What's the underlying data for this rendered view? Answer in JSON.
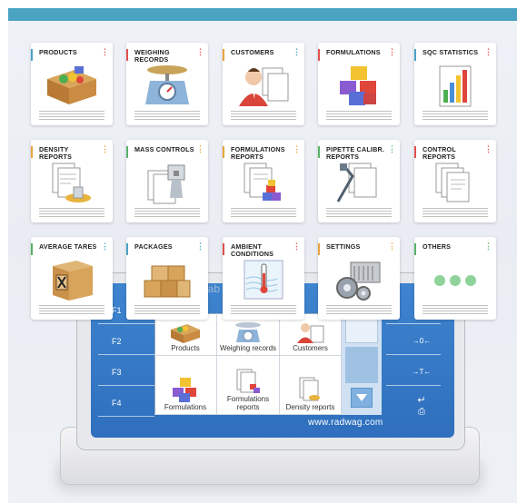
{
  "colors": {
    "red": "#e05050",
    "blue": "#4aa3c3",
    "yellow": "#e8a33c",
    "green": "#58b26a"
  },
  "cards": [
    {
      "title": "PRODUCTS",
      "accent": "#4aa3c3",
      "dots": "#e05050",
      "icon": "products-box-icon"
    },
    {
      "title": "WEIGHING RECORDS",
      "accent": "#e05050",
      "dots": "#e05050",
      "icon": "scale-icon"
    },
    {
      "title": "CUSTOMERS",
      "accent": "#e8a33c",
      "dots": "#4aa3c3",
      "icon": "customer-icon"
    },
    {
      "title": "FORMULATIONS",
      "accent": "#e05050",
      "dots": "#e05050",
      "icon": "cubes-icon"
    },
    {
      "title": "SQC STATISTICS",
      "accent": "#4aa3c3",
      "dots": "#e05050",
      "icon": "bar-chart-icon"
    },
    {
      "title": "DENSITY REPORTS",
      "accent": "#e8a33c",
      "dots": "#e8a33c",
      "icon": "density-report-icon"
    },
    {
      "title": "MASS CONTROLS",
      "accent": "#58b26a",
      "dots": "#e8a33c",
      "icon": "mass-control-icon"
    },
    {
      "title": "FORMULATIONS REPORTS",
      "accent": "#e8a33c",
      "dots": "#e8a33c",
      "icon": "formulation-report-icon"
    },
    {
      "title": "PIPETTE CALIBR. REPORTS",
      "accent": "#58b26a",
      "dots": "#58b26a",
      "icon": "pipette-icon"
    },
    {
      "title": "CONTROL REPORTS",
      "accent": "#e05050",
      "dots": "#e05050",
      "icon": "documents-icon"
    },
    {
      "title": "AVERAGE TARES",
      "accent": "#58b26a",
      "dots": "#4aa3c3",
      "icon": "tare-box-icon"
    },
    {
      "title": "PACKAGES",
      "accent": "#4aa3c3",
      "dots": "#4aa3c3",
      "icon": "packages-icon"
    },
    {
      "title": "AMBIENT CONDITIONS",
      "accent": "#e05050",
      "dots": "#e05050",
      "icon": "thermometer-icon"
    },
    {
      "title": "SETTINGS",
      "accent": "#e8a33c",
      "dots": "#e8a33c",
      "icon": "gears-icon"
    },
    {
      "title": "OTHERS",
      "accent": "#58b26a",
      "dots": "#58b26a",
      "icon": "more-dots-icon"
    }
  ],
  "device": {
    "panel_label": "Lab",
    "function_keys": [
      "F1",
      "F2",
      "F3",
      "F4"
    ],
    "right_keys": [
      "→0←",
      "→T←"
    ],
    "url": "www.radwag.com",
    "screen_items": [
      "Products",
      "Weighing records",
      "Customers",
      "Formulations",
      "Formulations reports",
      "Density reports"
    ]
  }
}
